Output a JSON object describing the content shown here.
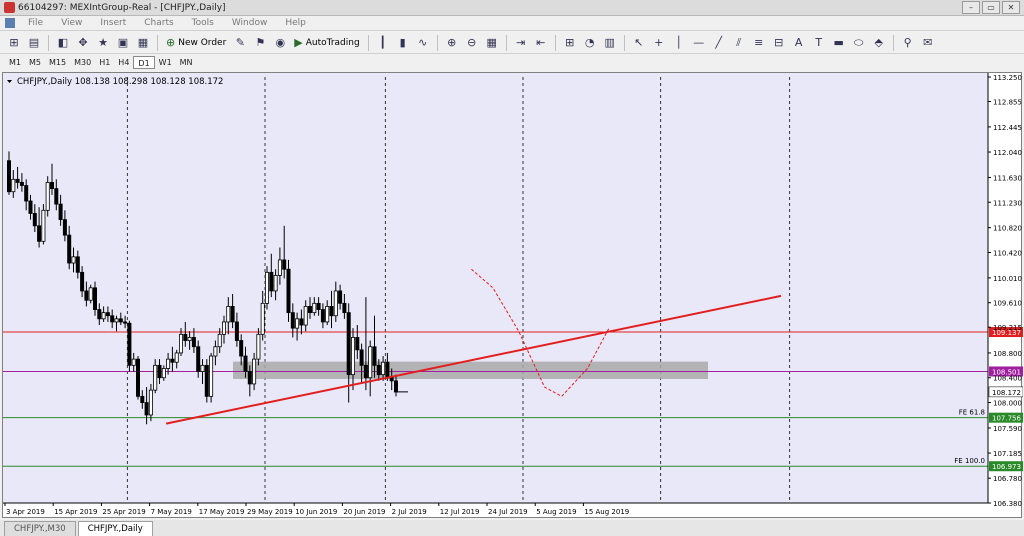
{
  "window": {
    "title": "66104297: MEXIntGroup-Real - [CHFJPY.,Daily]",
    "minimize": "–",
    "restore": "▭",
    "close": "✕"
  },
  "menu": [
    "File",
    "View",
    "Insert",
    "Charts",
    "Tools",
    "Window",
    "Help"
  ],
  "toolbar": {
    "new_order_label": "New Order",
    "autotrading_label": "AutoTrading"
  },
  "timeframes": [
    "M1",
    "M5",
    "M15",
    "M30",
    "H1",
    "H4",
    "D1",
    "W1",
    "MN"
  ],
  "active_timeframe": "D1",
  "chart_header": "CHFJPY.,Daily  108.138 108.298 108.128 108.172",
  "tabs": [
    "CHFJPY.,M30",
    "CHFJPY.,Daily"
  ],
  "active_tab": "CHFJPY.,Daily",
  "colors": {
    "background": "#e8e8f8",
    "bull": "#ffffff",
    "bear": "#000000",
    "trendline": "#e31e1e",
    "resistance": "#e31e1e",
    "pivot": "#a020a0",
    "fib": "#2a8a2a",
    "zone": "#a9a9a9"
  },
  "chart_data": {
    "type": "candlestick",
    "symbol": "CHFJPY.",
    "timeframe": "Daily",
    "ohlc_header": {
      "open": 108.138,
      "high": 108.298,
      "low": 108.128,
      "close": 108.172
    },
    "y_ticks": [
      113.25,
      112.855,
      112.445,
      112.04,
      111.63,
      111.23,
      110.82,
      110.42,
      110.01,
      109.61,
      109.215,
      108.8,
      108.4,
      108.0,
      107.59,
      107.185,
      106.78,
      106.38
    ],
    "x_ticks": [
      "3 Apr 2019",
      "15 Apr 2019",
      "25 Apr 2019",
      "7 May 2019",
      "17 May 2019",
      "29 May 2019",
      "10 Jun 2019",
      "20 Jun 2019",
      "2 Jul 2019",
      "12 Jul 2019",
      "24 Jul 2019",
      "5 Aug 2019",
      "15 Aug 2019"
    ],
    "y_range": [
      106.38,
      113.25
    ],
    "current_price": 108.172,
    "levels": [
      {
        "name": "resistance",
        "price": 109.137,
        "label": "109.137"
      },
      {
        "name": "pivot",
        "price": 108.501,
        "label": "108.501"
      },
      {
        "name": "fe-61.8",
        "price": 107.756,
        "label": "107.756",
        "tag": "FE 61.8"
      },
      {
        "name": "fe-100",
        "price": 106.973,
        "label": "106.973",
        "tag": "FE 100.0"
      }
    ],
    "zone": {
      "top": 108.66,
      "bottom": 108.38
    },
    "trendline": {
      "from": {
        "bar": 37,
        "price": 107.66
      },
      "to": {
        "bar": 180,
        "price": 109.72
      }
    },
    "candles": [
      [
        0,
        111.9,
        112.05,
        111.35,
        111.4
      ],
      [
        1,
        111.4,
        111.75,
        111.3,
        111.6
      ],
      [
        2,
        111.6,
        111.8,
        111.45,
        111.55
      ],
      [
        3,
        111.55,
        111.7,
        111.4,
        111.5
      ],
      [
        4,
        111.5,
        111.6,
        111.1,
        111.25
      ],
      [
        5,
        111.25,
        111.35,
        110.95,
        111.05
      ],
      [
        6,
        111.05,
        111.2,
        110.75,
        110.85
      ],
      [
        7,
        110.85,
        111.15,
        110.5,
        110.6
      ],
      [
        8,
        110.6,
        111.2,
        110.55,
        111.1
      ],
      [
        9,
        111.1,
        111.65,
        111.0,
        111.55
      ],
      [
        10,
        111.55,
        111.85,
        111.35,
        111.45
      ],
      [
        11,
        111.45,
        111.6,
        111.1,
        111.2
      ],
      [
        12,
        111.2,
        111.35,
        110.85,
        110.95
      ],
      [
        13,
        110.95,
        111.1,
        110.6,
        110.7
      ],
      [
        14,
        110.7,
        110.85,
        110.15,
        110.25
      ],
      [
        15,
        110.25,
        110.5,
        110.1,
        110.35
      ],
      [
        16,
        110.35,
        110.45,
        110.0,
        110.1
      ],
      [
        17,
        110.1,
        110.2,
        109.7,
        109.8
      ],
      [
        18,
        109.8,
        109.95,
        109.55,
        109.65
      ],
      [
        19,
        109.65,
        109.9,
        109.6,
        109.85
      ],
      [
        20,
        109.85,
        109.95,
        109.4,
        109.5
      ],
      [
        21,
        109.5,
        109.6,
        109.25,
        109.35
      ],
      [
        22,
        109.35,
        109.55,
        109.3,
        109.45
      ],
      [
        23,
        109.45,
        109.55,
        109.3,
        109.4
      ],
      [
        24,
        109.4,
        109.5,
        109.2,
        109.3
      ],
      [
        25,
        109.3,
        109.4,
        109.15,
        109.35
      ],
      [
        26,
        109.35,
        109.45,
        109.25,
        109.3
      ],
      [
        27,
        109.3,
        109.4,
        109.2,
        109.28
      ],
      [
        28,
        109.28,
        109.32,
        108.5,
        108.6
      ],
      [
        29,
        108.6,
        108.8,
        108.5,
        108.7
      ],
      [
        30,
        108.7,
        108.75,
        108.05,
        108.1
      ],
      [
        31,
        108.1,
        108.2,
        107.9,
        108.0
      ],
      [
        32,
        108.0,
        108.25,
        107.65,
        107.8
      ],
      [
        33,
        107.8,
        108.3,
        107.7,
        108.2
      ],
      [
        34,
        108.2,
        108.7,
        108.15,
        108.6
      ],
      [
        35,
        108.6,
        108.7,
        108.3,
        108.4
      ],
      [
        36,
        108.4,
        108.6,
        108.35,
        108.55
      ],
      [
        37,
        108.55,
        108.8,
        108.45,
        108.7
      ],
      [
        38,
        108.7,
        108.9,
        108.5,
        108.65
      ],
      [
        39,
        108.65,
        108.85,
        108.55,
        108.8
      ],
      [
        40,
        108.8,
        109.2,
        108.75,
        109.1
      ],
      [
        41,
        109.1,
        109.3,
        108.9,
        109.0
      ],
      [
        42,
        109.0,
        109.15,
        108.85,
        109.05
      ],
      [
        43,
        109.05,
        109.2,
        108.8,
        108.9
      ],
      [
        44,
        108.9,
        109.0,
        108.4,
        108.5
      ],
      [
        45,
        108.5,
        108.7,
        108.3,
        108.6
      ],
      [
        46,
        108.6,
        108.7,
        108.0,
        108.1
      ],
      [
        47,
        108.1,
        108.8,
        108.0,
        108.75
      ],
      [
        48,
        108.75,
        109.0,
        108.6,
        108.9
      ],
      [
        49,
        108.9,
        109.2,
        108.8,
        109.1
      ],
      [
        50,
        109.1,
        109.4,
        108.95,
        109.3
      ],
      [
        51,
        109.3,
        109.7,
        109.1,
        109.55
      ],
      [
        52,
        109.55,
        109.75,
        109.2,
        109.3
      ],
      [
        53,
        109.3,
        109.45,
        108.9,
        109.0
      ],
      [
        54,
        109.0,
        109.1,
        108.6,
        108.75
      ],
      [
        55,
        108.75,
        108.9,
        108.4,
        108.5
      ],
      [
        56,
        108.5,
        108.6,
        108.1,
        108.3
      ],
      [
        57,
        108.3,
        108.8,
        108.2,
        108.7
      ],
      [
        58,
        108.7,
        109.2,
        108.6,
        109.1
      ],
      [
        59,
        109.1,
        109.8,
        109.0,
        109.6
      ],
      [
        60,
        109.6,
        110.2,
        109.5,
        110.1
      ],
      [
        61,
        110.1,
        110.4,
        109.7,
        109.8
      ],
      [
        62,
        109.8,
        110.15,
        109.65,
        110.05
      ],
      [
        63,
        110.05,
        110.5,
        109.9,
        110.3
      ],
      [
        64,
        110.3,
        110.85,
        110.0,
        110.15
      ],
      [
        65,
        110.15,
        110.3,
        109.3,
        109.45
      ],
      [
        66,
        109.45,
        109.6,
        109.05,
        109.2
      ],
      [
        67,
        109.2,
        109.45,
        109.0,
        109.35
      ],
      [
        68,
        109.35,
        109.5,
        109.1,
        109.25
      ],
      [
        69,
        109.25,
        109.65,
        109.15,
        109.55
      ],
      [
        70,
        109.55,
        109.7,
        109.35,
        109.45
      ],
      [
        71,
        109.45,
        109.7,
        109.4,
        109.6
      ],
      [
        72,
        109.6,
        109.7,
        109.4,
        109.5
      ],
      [
        73,
        109.5,
        109.6,
        109.2,
        109.3
      ],
      [
        74,
        109.3,
        109.65,
        109.25,
        109.55
      ],
      [
        75,
        109.55,
        109.8,
        109.2,
        109.4
      ],
      [
        76,
        109.4,
        109.95,
        109.3,
        109.8
      ],
      [
        77,
        109.8,
        109.9,
        109.5,
        109.6
      ],
      [
        78,
        109.6,
        109.75,
        109.35,
        109.45
      ],
      [
        79,
        109.45,
        109.6,
        108.0,
        108.45
      ],
      [
        80,
        108.45,
        109.2,
        108.2,
        109.05
      ],
      [
        81,
        109.05,
        109.25,
        108.7,
        108.85
      ],
      [
        82,
        108.85,
        108.95,
        108.3,
        108.6
      ],
      [
        83,
        108.6,
        109.7,
        108.2,
        108.4
      ],
      [
        84,
        108.4,
        109.0,
        108.1,
        108.9
      ],
      [
        85,
        108.9,
        109.4,
        108.4,
        108.6
      ],
      [
        86,
        108.6,
        108.7,
        108.35,
        108.45
      ],
      [
        87,
        108.45,
        108.75,
        108.35,
        108.65
      ],
      [
        88,
        108.65,
        108.8,
        108.35,
        108.4
      ],
      [
        89,
        108.4,
        108.55,
        108.2,
        108.35
      ],
      [
        90,
        108.35,
        108.45,
        108.1,
        108.17
      ]
    ]
  }
}
